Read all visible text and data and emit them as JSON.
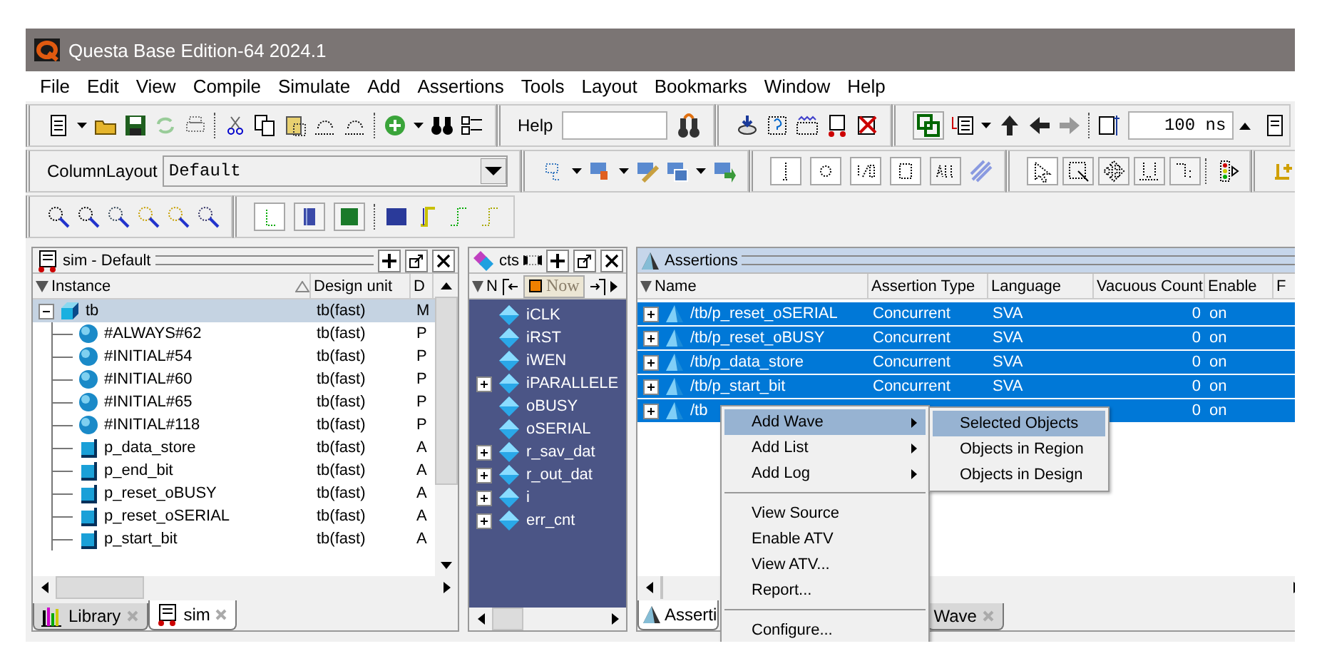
{
  "window": {
    "title": "Questa Base Edition-64 2024.1"
  },
  "menu": [
    "File",
    "Edit",
    "View",
    "Compile",
    "Simulate",
    "Add",
    "Assertions",
    "Tools",
    "Layout",
    "Bookmarks",
    "Window",
    "Help"
  ],
  "toolbar": {
    "help_label": "Help",
    "time_value": "100 ns",
    "column_layout_label": "ColumnLayout",
    "column_layout_value": "Default"
  },
  "sim_panel": {
    "title": "sim - Default",
    "columns": [
      "Instance",
      "Design unit",
      "D"
    ],
    "rows": [
      {
        "name": "tb",
        "design_unit": "tb(fast)",
        "column_3": "M",
        "kind": "module",
        "selected": true,
        "expanded": true,
        "children": [
          {
            "name": "#ALWAYS#62",
            "design_unit": "tb(fast)",
            "column_3": "P",
            "kind": "process",
            "selected": false
          },
          {
            "name": "#INITIAL#54",
            "design_unit": "tb(fast)",
            "column_3": "P",
            "kind": "process",
            "selected": false
          },
          {
            "name": "#INITIAL#60",
            "design_unit": "tb(fast)",
            "column_3": "P",
            "kind": "process",
            "selected": false
          },
          {
            "name": "#INITIAL#65",
            "design_unit": "tb(fast)",
            "column_3": "P",
            "kind": "process",
            "selected": false
          },
          {
            "name": "#INITIAL#118",
            "design_unit": "tb(fast)",
            "column_3": "P",
            "kind": "process",
            "selected": false
          },
          {
            "name": "p_data_store",
            "design_unit": "tb(fast)",
            "column_3": "A",
            "kind": "assertion",
            "selected": false
          },
          {
            "name": "p_end_bit",
            "design_unit": "tb(fast)",
            "column_3": "A",
            "kind": "assertion",
            "selected": false
          },
          {
            "name": "p_reset_oBUSY",
            "design_unit": "tb(fast)",
            "column_3": "A",
            "kind": "assertion",
            "selected": false
          },
          {
            "name": "p_reset_oSERIAL",
            "design_unit": "tb(fast)",
            "column_3": "A",
            "kind": "assertion",
            "selected": false
          },
          {
            "name": "p_start_bit",
            "design_unit": "tb(fast)",
            "column_3": "A",
            "kind": "assertion",
            "selected": false
          }
        ]
      }
    ],
    "tabs": [
      {
        "label": "Library",
        "selected": false
      },
      {
        "label": "sim",
        "selected": true
      }
    ]
  },
  "objects_panel": {
    "title": "cts",
    "column_fragment": "N",
    "now_label": "Now",
    "items": [
      {
        "name": "iCLK",
        "expandable": false
      },
      {
        "name": "iRST",
        "expandable": false
      },
      {
        "name": "iWEN",
        "expandable": false
      },
      {
        "name": "iPARALLELE",
        "expandable": true
      },
      {
        "name": "oBUSY",
        "expandable": false
      },
      {
        "name": "oSERIAL",
        "expandable": false
      },
      {
        "name": "r_sav_dat",
        "expandable": true
      },
      {
        "name": "r_out_dat",
        "expandable": true
      },
      {
        "name": "i",
        "expandable": true
      },
      {
        "name": "err_cnt",
        "expandable": true
      }
    ]
  },
  "assertions_panel": {
    "title": "Assertions",
    "columns": [
      "Name",
      "Assertion Type",
      "Language",
      "Vacuous Count",
      "Enable",
      "F"
    ],
    "rows": [
      {
        "name": "/tb/p_reset_oSERIAL",
        "type": "Concurrent",
        "language": "SVA",
        "vacuous_count": "0",
        "enable": "on",
        "selected": true
      },
      {
        "name": "/tb/p_reset_oBUSY",
        "type": "Concurrent",
        "language": "SVA",
        "vacuous_count": "0",
        "enable": "on",
        "selected": true
      },
      {
        "name": "/tb/p_data_store",
        "type": "Concurrent",
        "language": "SVA",
        "vacuous_count": "0",
        "enable": "on",
        "selected": true
      },
      {
        "name": "/tb/p_start_bit",
        "type": "Concurrent",
        "language": "SVA",
        "vacuous_count": "0",
        "enable": "on",
        "selected": true
      },
      {
        "name": "/tb",
        "vacuous_count": "0",
        "enable": "on",
        "selected": true
      }
    ],
    "tabs": [
      {
        "label": "Asserti",
        "selected": true
      },
      {
        "label": "Wave",
        "selected": false
      }
    ]
  },
  "context_menu": {
    "groups": [
      [
        {
          "label": "Add Wave",
          "submenu": true,
          "selected": true
        },
        {
          "label": "Add List",
          "submenu": true,
          "selected": false
        },
        {
          "label": "Add Log",
          "submenu": true,
          "selected": false
        }
      ],
      [
        {
          "label": "View Source",
          "submenu": false,
          "selected": false
        },
        {
          "label": "Enable ATV",
          "submenu": false,
          "selected": false
        },
        {
          "label": "View ATV...",
          "submenu": false,
          "selected": false
        },
        {
          "label": "Report...",
          "submenu": false,
          "selected": false
        }
      ],
      [
        {
          "label": "Configure...",
          "submenu": false,
          "selected": false
        }
      ]
    ],
    "submenu": [
      {
        "label": "Selected Objects",
        "selected": true
      },
      {
        "label": "Objects in Region",
        "selected": false
      },
      {
        "label": "Objects in Design",
        "selected": false
      }
    ]
  }
}
